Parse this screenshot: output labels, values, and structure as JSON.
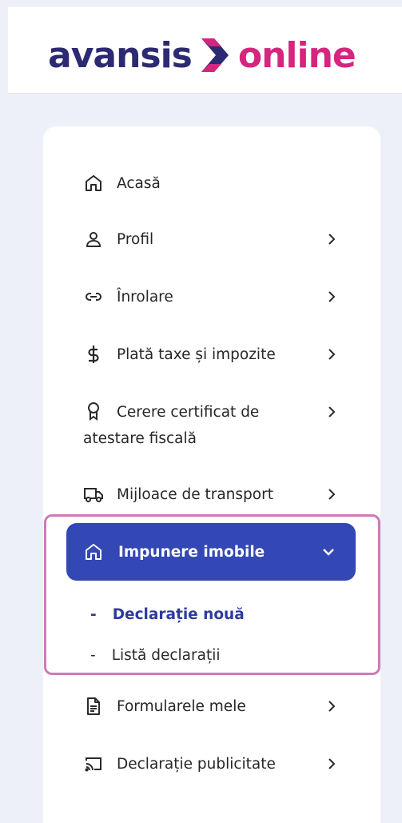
{
  "brand": {
    "part1": "avansis",
    "part2": "online",
    "colors": {
      "primary": "#2c2a72",
      "accent": "#d6257e"
    }
  },
  "menu": {
    "home": "Acasă",
    "profile": "Profil",
    "enrollment": "Înrolare",
    "payment": "Plată taxe și impozite",
    "certificate": "Cerere certificat de atestare fiscală",
    "transport": "Mijloace de transport",
    "property": "Impunere imobile",
    "new_declaration": "Declarație nouă",
    "declaration_list": "Listă declarații",
    "forms": "Formularele mele",
    "advertising": "Declarație publicitate"
  },
  "colors": {
    "active_bg": "#3347b5",
    "highlight_border": "#cf7ab8",
    "page_bg": "#eef0f9"
  }
}
